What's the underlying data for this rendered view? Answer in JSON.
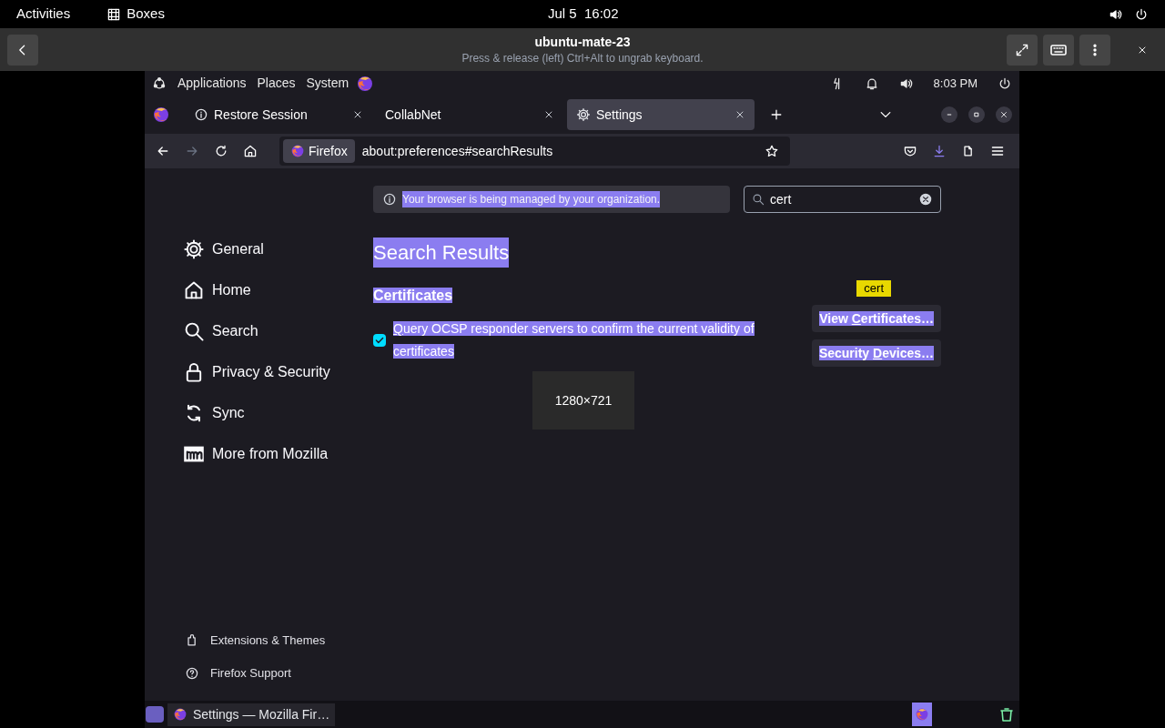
{
  "top_bar": {
    "activities": "Activities",
    "app": "Boxes",
    "clock": "Jul 5  16:02"
  },
  "boxes_header": {
    "title": "ubuntu-mate-23",
    "subtitle": "Press & release (left) Ctrl+Alt to ungrab keyboard."
  },
  "guest_panel": {
    "menus": [
      "Applications",
      "Places",
      "System"
    ],
    "clock": "8:03 PM"
  },
  "tabs": [
    {
      "label": "Restore Session",
      "selected": false
    },
    {
      "label": "CollabNet",
      "selected": false
    },
    {
      "label": "Settings",
      "selected": true
    }
  ],
  "url_bar": {
    "identity": "Firefox",
    "url": "about:preferences#searchResults"
  },
  "notice": "Your browser is being managed by your organization.",
  "search_field": {
    "value": "cert"
  },
  "sidebar": {
    "items": [
      {
        "label": "General",
        "selected": false
      },
      {
        "label": "Home",
        "selected": false
      },
      {
        "label": "Search",
        "selected": false
      },
      {
        "label": "Privacy & Security",
        "selected": false
      },
      {
        "label": "Sync",
        "selected": false
      },
      {
        "label": "More from Mozilla",
        "selected": false
      }
    ],
    "footer": [
      {
        "label": "Extensions & Themes"
      },
      {
        "label": "Firefox Support"
      }
    ]
  },
  "heading": "Search Results",
  "section": "Certificates",
  "ocsp": {
    "parts": {
      "key": "Q",
      "after": "uery OCSP responder servers to confirm the current validity of certificates"
    },
    "checked": true
  },
  "buttons": [
    {
      "parts": {
        "before": "View ",
        "key": "C",
        "after": "ertificates…"
      }
    },
    {
      "parts": {
        "before": "Security ",
        "key": "D",
        "after": "evices…"
      }
    }
  ],
  "search_tooltip": "cert",
  "resize_label": "1280×721",
  "taskbar": {
    "window": "Settings — Mozilla Fir…"
  }
}
